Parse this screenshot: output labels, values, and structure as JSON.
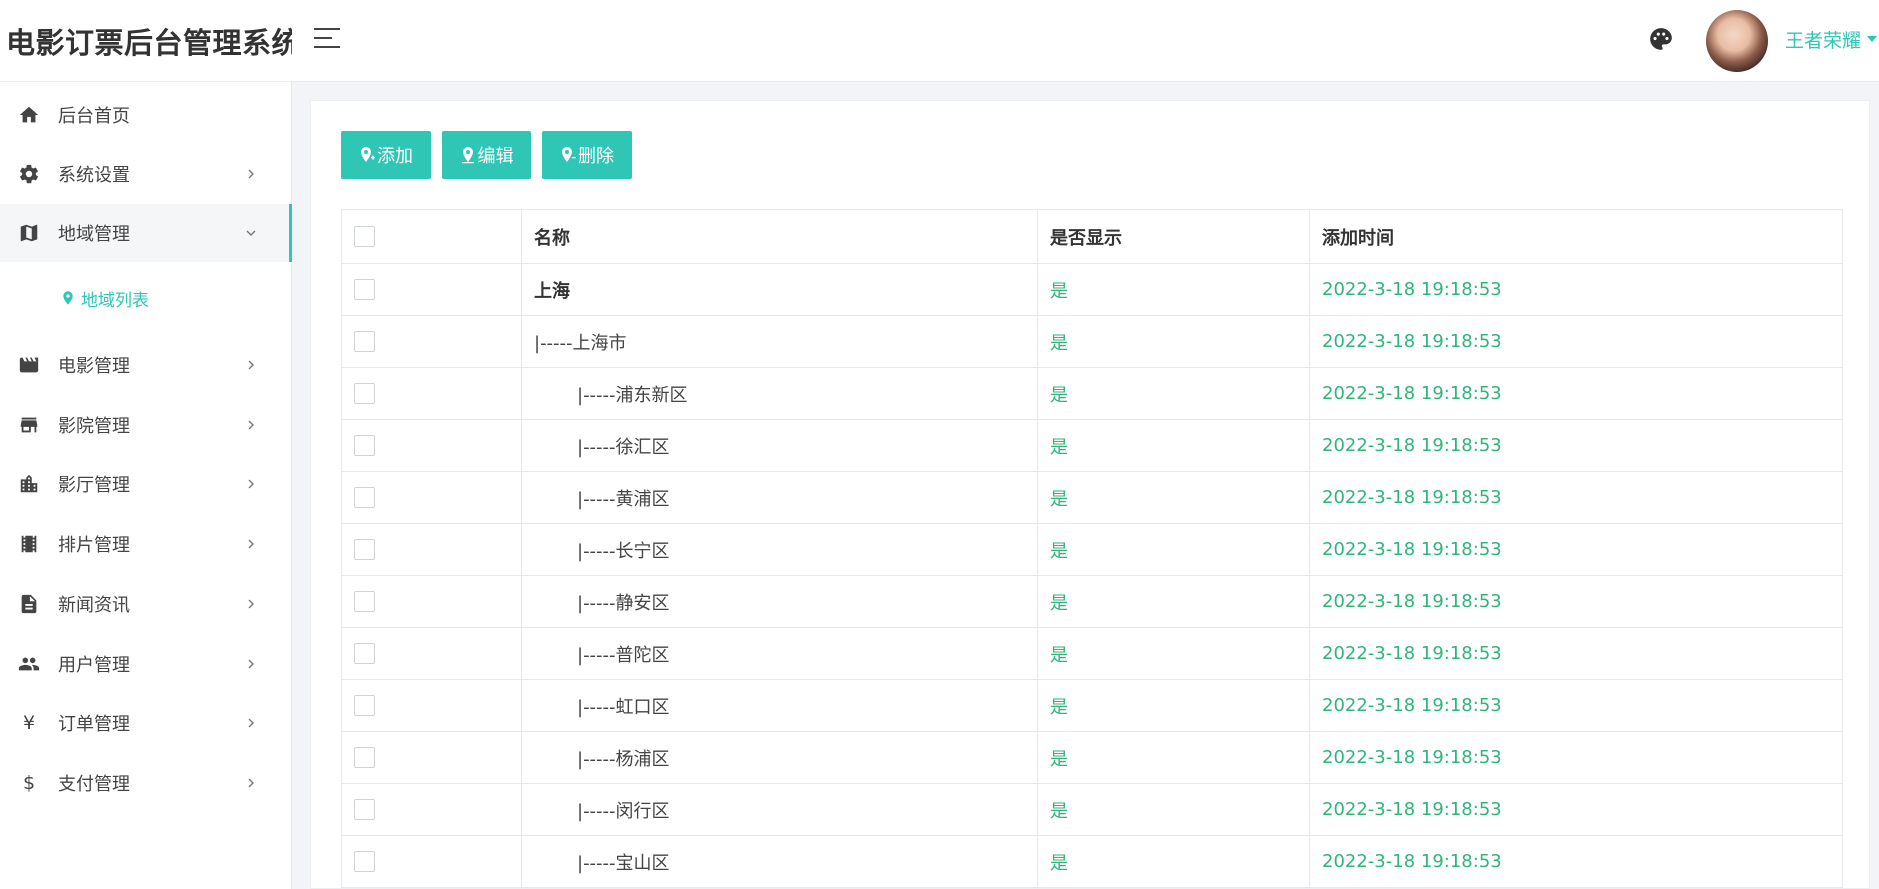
{
  "app": {
    "title": "电影订票后台管理系统"
  },
  "header": {
    "username": "王者荣耀",
    "icons": [
      "menu-icon",
      "palette-icon",
      "avatar",
      "caret-down-icon"
    ]
  },
  "colors": {
    "accent": "#2fc6b5",
    "status_green": "#2fb57a"
  },
  "sidebar": {
    "items": [
      {
        "label": "后台首页",
        "icon": "home-icon",
        "has_children": false
      },
      {
        "label": "系统设置",
        "icon": "gear-icon",
        "has_children": true
      },
      {
        "label": "地域管理",
        "icon": "map-icon",
        "has_children": true,
        "active": true,
        "children": [
          {
            "label": "地域列表",
            "icon": "location-pin-icon"
          }
        ]
      },
      {
        "label": "电影管理",
        "icon": "clapperboard-icon",
        "has_children": true
      },
      {
        "label": "影院管理",
        "icon": "store-icon",
        "has_children": true
      },
      {
        "label": "影厅管理",
        "icon": "building-icon",
        "has_children": true
      },
      {
        "label": "排片管理",
        "icon": "film-strip-icon",
        "has_children": true
      },
      {
        "label": "新闻资讯",
        "icon": "document-icon",
        "has_children": true
      },
      {
        "label": "用户管理",
        "icon": "people-icon",
        "has_children": true
      },
      {
        "label": "订单管理",
        "icon": "yen-icon",
        "has_children": true
      },
      {
        "label": "支付管理",
        "icon": "dollar-icon",
        "has_children": true
      }
    ]
  },
  "toolbar": {
    "add_label": "添加",
    "edit_label": "编辑",
    "delete_label": "删除"
  },
  "table": {
    "columns": [
      "名称",
      "是否显示",
      "添加时间"
    ],
    "rows": [
      {
        "name": "上海",
        "level": 0,
        "show": "是",
        "time": "2022-3-18 19:18:53"
      },
      {
        "name": "|-----上海市",
        "level": 1,
        "show": "是",
        "time": "2022-3-18 19:18:53"
      },
      {
        "name": "|-----浦东新区",
        "level": 2,
        "show": "是",
        "time": "2022-3-18 19:18:53"
      },
      {
        "name": "|-----徐汇区",
        "level": 2,
        "show": "是",
        "time": "2022-3-18 19:18:53"
      },
      {
        "name": "|-----黄浦区",
        "level": 2,
        "show": "是",
        "time": "2022-3-18 19:18:53"
      },
      {
        "name": "|-----长宁区",
        "level": 2,
        "show": "是",
        "time": "2022-3-18 19:18:53"
      },
      {
        "name": "|-----静安区",
        "level": 2,
        "show": "是",
        "time": "2022-3-18 19:18:53"
      },
      {
        "name": "|-----普陀区",
        "level": 2,
        "show": "是",
        "time": "2022-3-18 19:18:53"
      },
      {
        "name": "|-----虹口区",
        "level": 2,
        "show": "是",
        "time": "2022-3-18 19:18:53"
      },
      {
        "name": "|-----杨浦区",
        "level": 2,
        "show": "是",
        "time": "2022-3-18 19:18:53"
      },
      {
        "name": "|-----闵行区",
        "level": 2,
        "show": "是",
        "time": "2022-3-18 19:18:53"
      },
      {
        "name": "|-----宝山区",
        "level": 2,
        "show": "是",
        "time": "2022-3-18 19:18:53"
      }
    ]
  }
}
